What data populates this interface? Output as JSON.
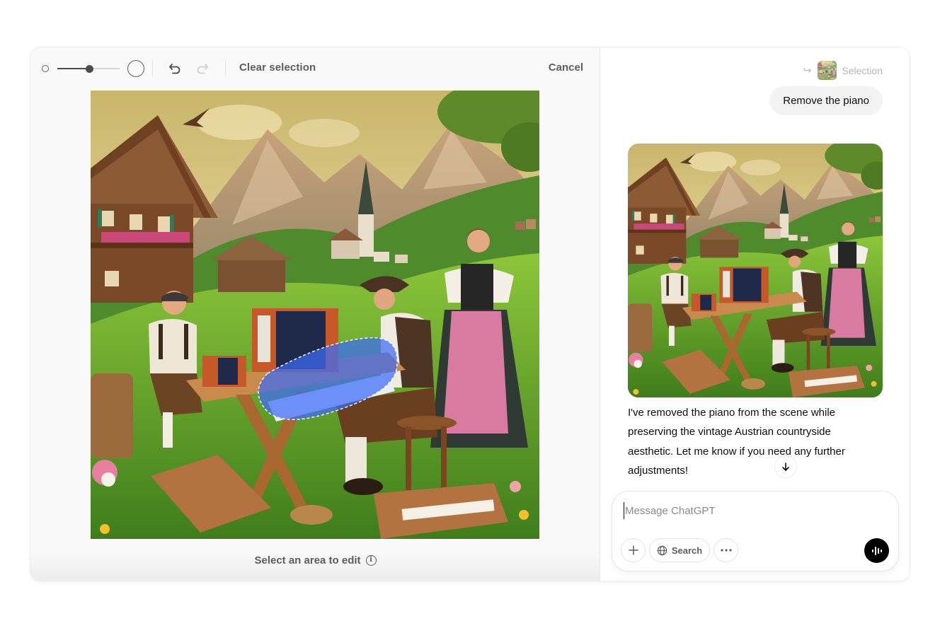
{
  "editor": {
    "brush_size": {
      "min_icon": "brush-small-icon",
      "max_icon": "brush-large-icon",
      "value_fraction": 0.52
    },
    "toolbar": {
      "undo_icon": "undo-icon",
      "redo_icon": "redo-icon",
      "redo_enabled": false,
      "clear_selection_label": "Clear selection",
      "cancel_label": "Cancel"
    },
    "image": {
      "description": "Vintage painting of an Austrian alpine village: wooden chalets, church spire, mountains; a boy, a man in a hat and a woman in a pink dirndl around a wooden table with accordions; a blue dashed selection mask over the piano keyboard",
      "selection_color": "#3b6cf6"
    },
    "hint": {
      "label": "Select an area to edit",
      "icon": "info-icon"
    }
  },
  "chat": {
    "selection_ref": {
      "icon": "reply-arrow-icon",
      "label": "Selection"
    },
    "user_message": "Remove the piano",
    "assistant_image": {
      "description": "Edited painting with the piano removed"
    },
    "assistant_message": "I've removed the piano from the scene while preserving the vintage Austrian countryside aesthetic. Let me know if you need any further adjustments!",
    "scroll_down_icon": "arrow-down-icon",
    "composer": {
      "placeholder": "Message ChatGPT",
      "value": "",
      "attach_icon": "plus-icon",
      "search_label": "Search",
      "search_icon": "globe-icon",
      "more_icon": "ellipsis-icon",
      "voice_icon": "voice-waveform-icon"
    }
  }
}
